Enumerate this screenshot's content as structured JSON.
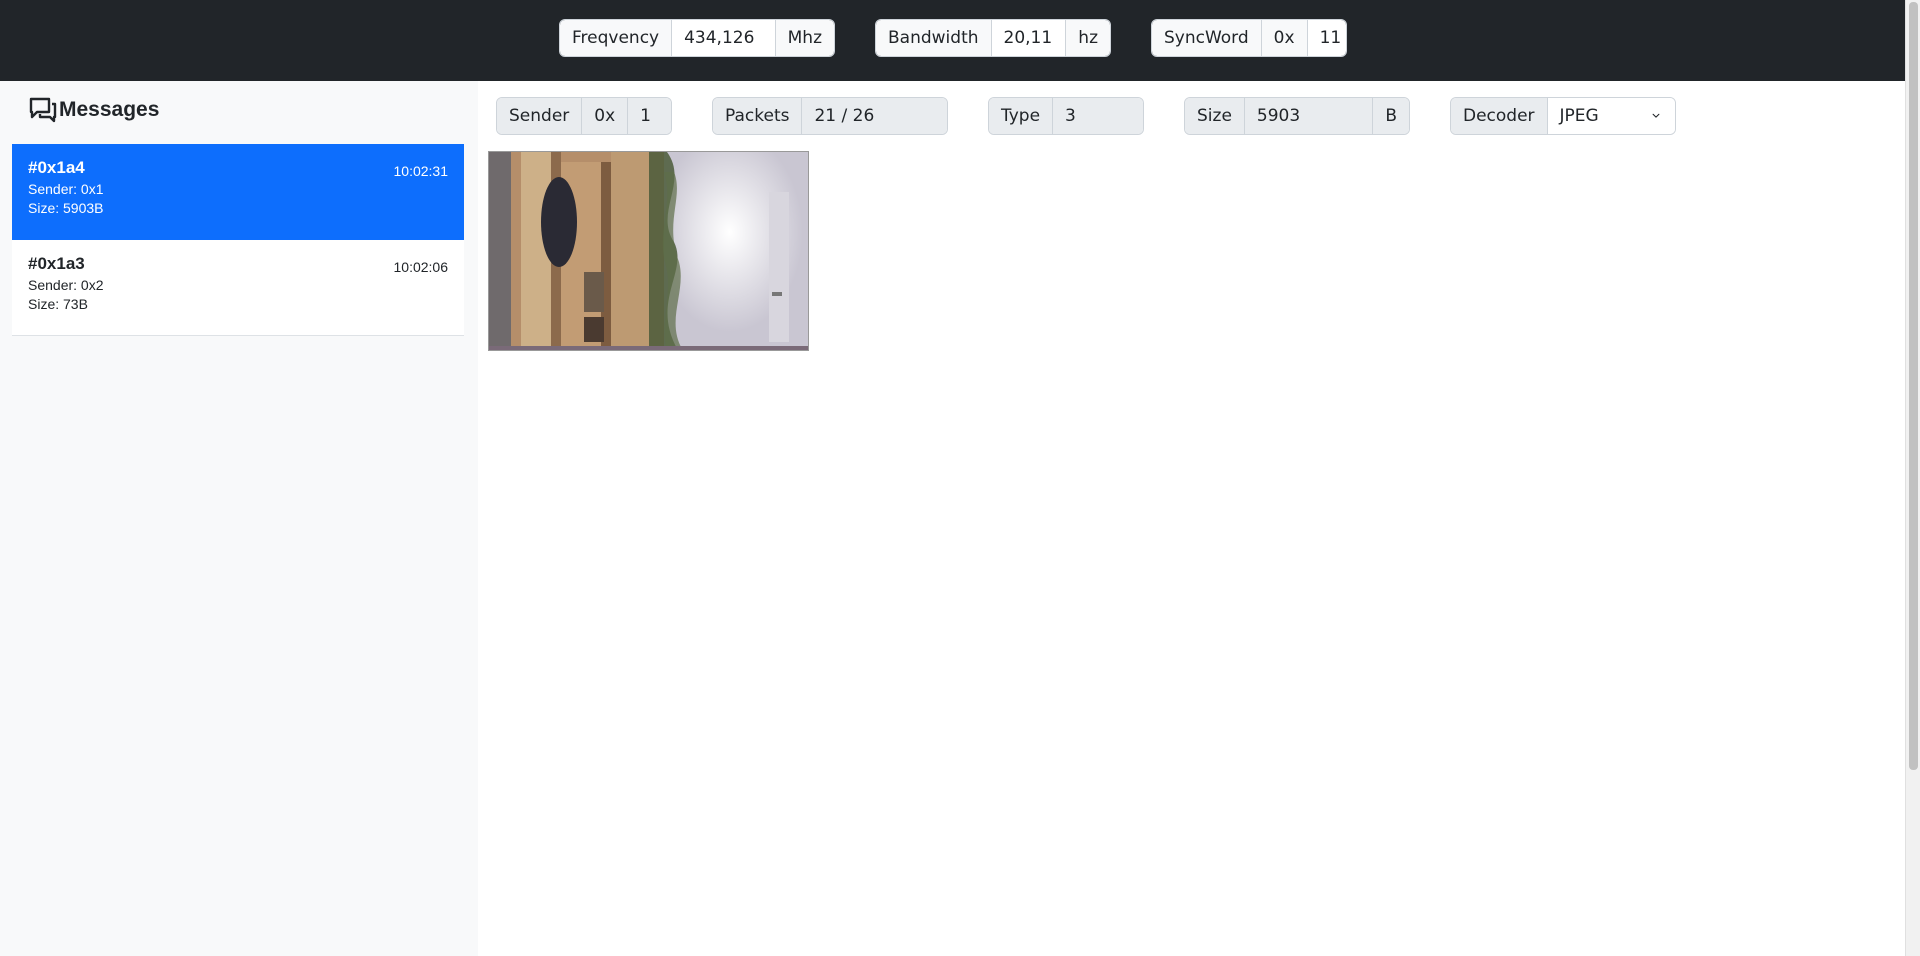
{
  "radio": {
    "frequency": {
      "label": "Freqvency",
      "value": "434,126",
      "unit": "Mhz"
    },
    "bandwidth": {
      "label": "Bandwidth",
      "value": "20,11",
      "unit": "hz"
    },
    "syncword": {
      "label": "SyncWord",
      "prefix": "0x",
      "value": "11"
    }
  },
  "sidebar": {
    "title": "Messages",
    "messages": [
      {
        "id": "#0x1a4",
        "time": "10:02:31",
        "sender": "Sender: 0x1",
        "size": "Size: 5903B"
      },
      {
        "id": "#0x1a3",
        "time": "10:02:06",
        "sender": "Sender: 0x2",
        "size": "Size: 73B"
      }
    ]
  },
  "detail": {
    "sender": {
      "label": "Sender",
      "prefix": "0x",
      "value": "1"
    },
    "packets": {
      "label": "Packets",
      "value": "21 / 26"
    },
    "type": {
      "label": "Type",
      "value": "3"
    },
    "size": {
      "label": "Size",
      "value": "5903",
      "unit": "B"
    },
    "decoder": {
      "label": "Decoder",
      "selected": "JPEG"
    }
  },
  "colors": {
    "navbar": "#212529",
    "active": "#0d6efd",
    "sidebar": "#f8f9fa"
  },
  "icons": {
    "title_icon": "chat-bubbles-icon",
    "select_icon": "chevron-down-icon"
  }
}
